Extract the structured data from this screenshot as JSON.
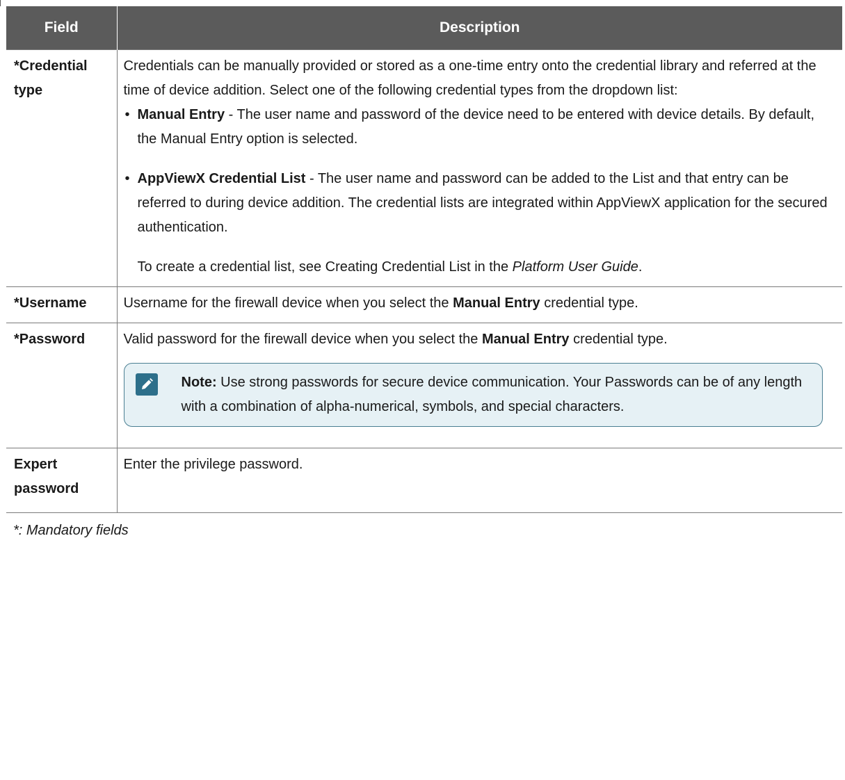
{
  "table": {
    "headers": {
      "field": "Field",
      "description": "Description"
    },
    "rows": {
      "credential_type": {
        "field": "*Credential type",
        "intro": "Credentials can be manually provided or stored as a one-time entry onto the credential library and referred at the time of device addition. Select one of the following credential types from the dropdown list:",
        "bullet_char": "•",
        "manual_entry_label": "Manual Entry",
        "manual_entry_text": " - The user name and password of the device need to be entered with device details. By default, the Manual Entry option is selected.",
        "appviewx_label": "AppViewX Credential List",
        "appviewx_text": " - The user name and password can be added to the List and that entry can be referred to during device addition. The credential lists are integrated within AppViewX application for the secured authentication.",
        "create_list_prefix": "To create a credential list, see Creating Credential List in the ",
        "create_list_guide": "Platform User Guide",
        "create_list_suffix": "."
      },
      "username": {
        "field": "*Username",
        "text_prefix": "Username for the firewall device when you select the ",
        "text_bold": "Manual Entry",
        "text_suffix": " credential type."
      },
      "password": {
        "field": "*Password",
        "text_prefix": "Valid password for the firewall device when you select the ",
        "text_bold": "Manual Entry",
        "text_suffix": " credential type.",
        "note_label": "Note:",
        "note_text": " Use strong passwords for secure device communication. Your Passwords can be of any length with a combination of alpha-numerical, symbols, and special characters.",
        "note_icon": "pencil-icon"
      },
      "expert_password": {
        "field": "Expert password",
        "text": "Enter the privilege password."
      }
    },
    "footer": "*: Mandatory fields"
  },
  "colors": {
    "header_bg": "#5b5b5b",
    "header_text": "#ffffff",
    "note_bg": "#e6f1f5",
    "note_border": "#4a7f92",
    "note_icon_bg": "#2d6f8a"
  }
}
